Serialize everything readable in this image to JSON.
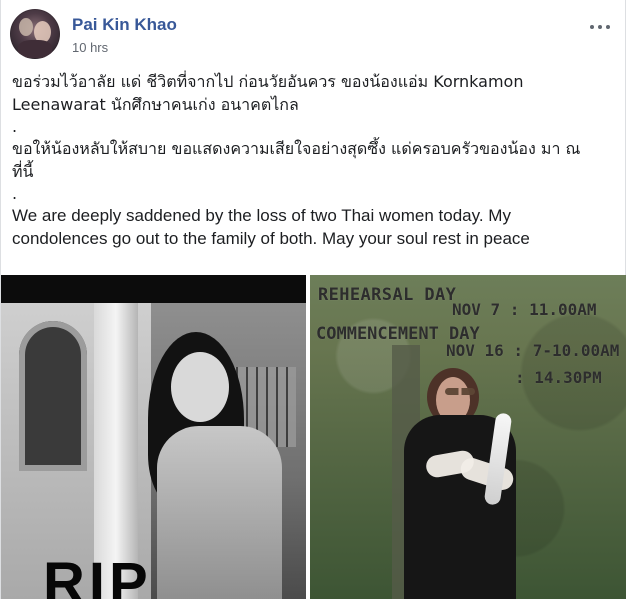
{
  "post": {
    "author": "Pai Kin Khao",
    "time": "10 hrs",
    "menu_icon": "more-options",
    "text_lines": [
      "ขอร่วมไว้อาลัย แด่ ชีวิตที่จากไป ก่อนวัยอันควร ของน้องแอ่ม Kornkamon",
      "Leenawarat นักศึกษาคนเก่ง อนาคตไกล",
      ".",
      "ขอให้น้องหลับให้สบาย ขอแสดงความเสียใจอย่างสุดซึ้ง แด่ครอบครัวของน้อง มา ณ",
      "ที่นี้",
      ".",
      "We are deeply saddened by the loss of two Thai women today. My",
      "condolences go out to the family of both. May your soul rest in peace"
    ]
  },
  "images": {
    "left": {
      "overlay_text": "RIP"
    },
    "right": {
      "lines": [
        "REHEARSAL DAY",
        "NOV 7 : 11.00AM",
        "COMMENCEMENT DAY",
        "NOV 16 : 7-10.00AM",
        ": 14.30PM"
      ]
    }
  },
  "colors": {
    "author_blue": "#385898",
    "text_dark": "#1c1e21",
    "meta_gray": "#616770"
  }
}
